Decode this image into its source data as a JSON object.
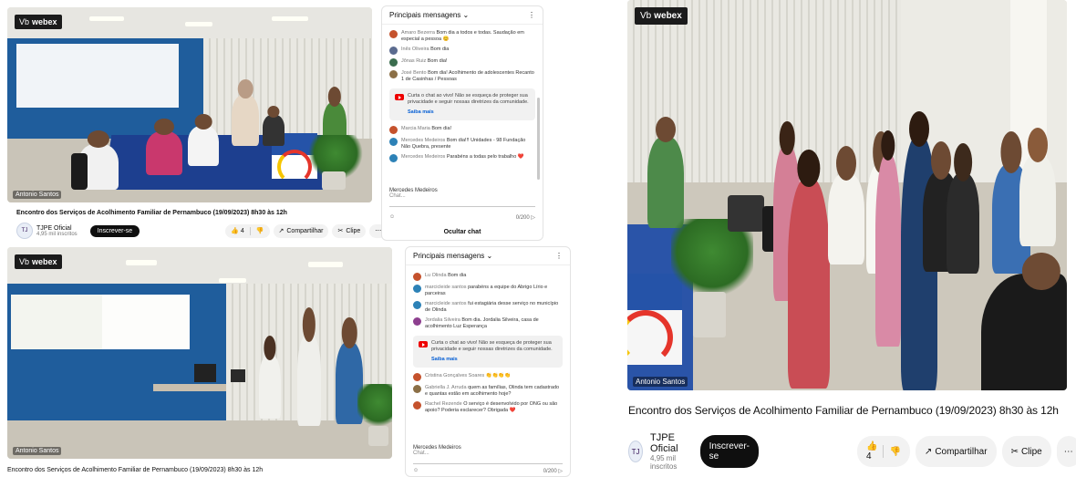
{
  "webex": {
    "prefix": "Vb",
    "brand": "webex"
  },
  "video_title": "Encontro dos Serviços de Acolhimento Familiar de Pernambuco (19/09/2023) 8h30 às 12h",
  "channel": {
    "name": "TJPE Oficial",
    "subs": "4,95 mil inscritos",
    "subscribe": "Inscrever-se"
  },
  "actions": {
    "likes": "4",
    "share": "Compartilhar",
    "clip": "Clipe",
    "more": "⋯"
  },
  "speaker_tag": "Antonio Santos",
  "chat_top": {
    "header": "Principais mensagens",
    "messages": [
      {
        "name": "Amaro Bezerra",
        "text": "Bom dia a todos e todas. Saudação em especial a pessoa 😊",
        "color": "#c5522d"
      },
      {
        "name": "Inês Oliveira",
        "text": "Bom dia",
        "color": "#5b6b8f"
      },
      {
        "name": "Jônas Ruiz",
        "text": "Bom dia!",
        "color": "#3b6d4e"
      },
      {
        "name": "José Bento",
        "text": "Bom dia! Acolhimento de adolescentes Recanto 1 de Casinhas / Pessoas",
        "color": "#8b6f46"
      }
    ],
    "notice": "Curta o chat ao vivo! Não se esqueça de proteger sua privacidade e seguir nossas diretrizes da comunidade.",
    "notice_more": "Saiba mais",
    "messages2": [
      {
        "name": "Marcia Maria",
        "text": "Bom dia!",
        "color": "#c5522d"
      },
      {
        "name": "Mercedes Medeiros",
        "text": "Bom dia!!! Unidades - 98 Fundação Não Quebra, presente",
        "color": "#2d82b7"
      },
      {
        "name": "Mercedes Medeiros",
        "text": "Parabéns a todas pelo trabalho ❤️",
        "color": "#2d82b7"
      }
    ],
    "user": "Mercedes Medeiros",
    "placeholder": "Chat...",
    "counter": "0/200",
    "hide": "Ocultar chat"
  },
  "chat_bottom": {
    "header": "Principais mensagens",
    "messages": [
      {
        "name": "Lu Olinda",
        "text": "Bom dia",
        "color": "#c5522d"
      },
      {
        "name": "marcicleide santos",
        "text": "parabéns a equipe do Abrigo Lírio e parceiras",
        "color": "#2d82b7"
      },
      {
        "name": "marcicleide santos",
        "text": "fui estagiária desse serviço no município de Olinda",
        "color": "#2d82b7"
      },
      {
        "name": "Jordalia Silveira",
        "text": "Bom dia. Jordalia Silveira, casa de acolhimento Luz Esperança",
        "color": "#8d3f8f"
      }
    ],
    "notice": "Curta o chat ao vivo! Não se esqueça de proteger sua privacidade e seguir nossas diretrizes da comunidade.",
    "notice_more": "Saiba mais",
    "messages2": [
      {
        "name": "Cristina Gonçalves Soares",
        "text": "👏👏👏👏",
        "color": "#c5522d"
      },
      {
        "name": "Gabriella J. Arruda",
        "text": "quem as famílias, Olinda tem cadastrado e quantas estão em acolhimento hoje?",
        "color": "#8b6f46"
      },
      {
        "name": "Rachel Rezende",
        "text": "O serviço é desenvolvido por ONG ou são apoio? Poderia esclarecer? Obrigada ❤️",
        "color": "#c5522d"
      }
    ],
    "user": "Mercedes Medeiros",
    "placeholder": "Chat...",
    "counter": "0/200"
  }
}
